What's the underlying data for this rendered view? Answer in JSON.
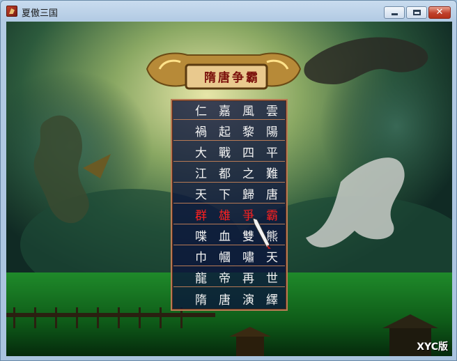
{
  "window": {
    "title": "夏傲三国",
    "controls": {
      "minimize": "minimize",
      "maximize": "maximize",
      "close": "✕"
    }
  },
  "game": {
    "title_plaque": "隋唐争霸",
    "menu": [
      {
        "text": "仁嘉風雲",
        "selected": false
      },
      {
        "text": "禍起黎陽",
        "selected": false
      },
      {
        "text": "大戰四平",
        "selected": false
      },
      {
        "text": "江都之難",
        "selected": false
      },
      {
        "text": "天下歸唐",
        "selected": false
      },
      {
        "text": "群雄爭霸",
        "selected": true
      },
      {
        "text": "喋血雙熊",
        "selected": false
      },
      {
        "text": "巾幗嘯天",
        "selected": false
      },
      {
        "text": "龍帝再世",
        "selected": false
      },
      {
        "text": "隋唐演繹",
        "selected": false
      }
    ],
    "version_label": "XYC版"
  },
  "colors": {
    "menu_text": "#ffffff",
    "selected_text": "#ff2020",
    "menu_border": "#b87a55",
    "plaque_text": "#7a0f0a"
  }
}
